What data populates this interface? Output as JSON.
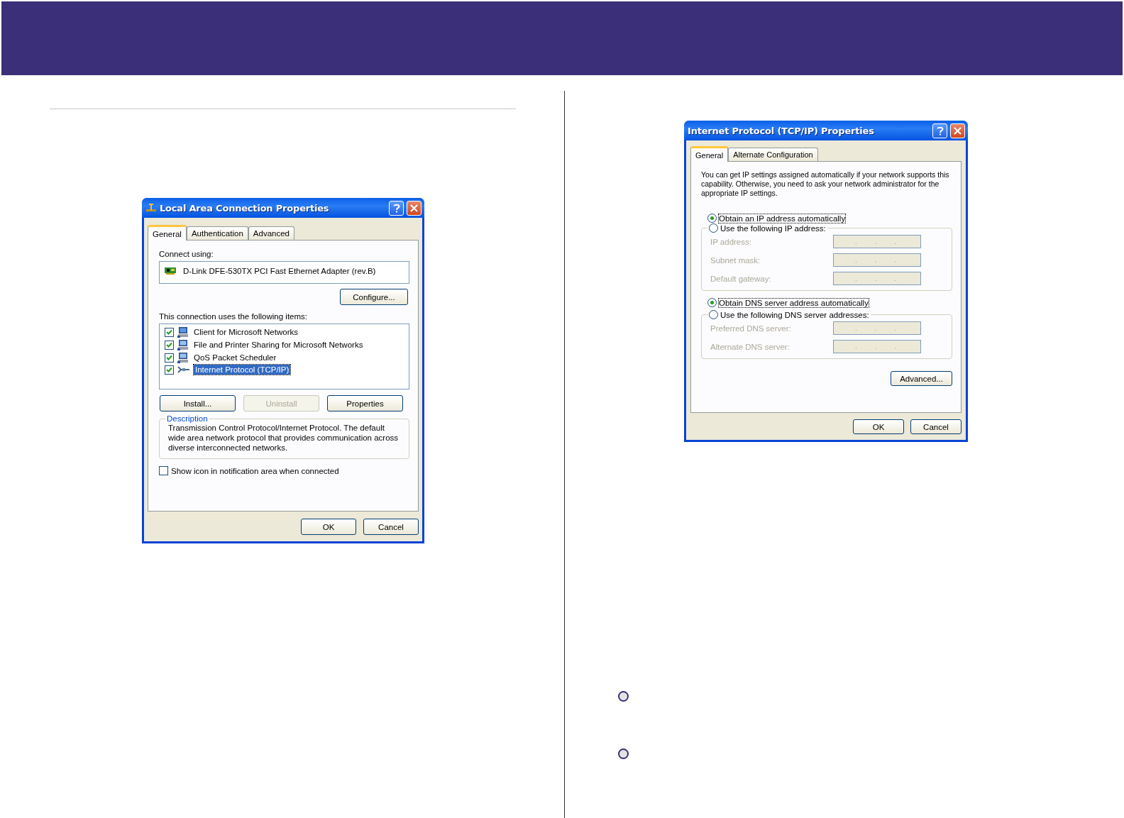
{
  "connection_dialog": {
    "title": "Local Area Connection Properties",
    "tabs": [
      {
        "label": "General",
        "selected": true
      },
      {
        "label": "Authentication",
        "selected": false
      },
      {
        "label": "Advanced",
        "selected": false
      }
    ],
    "connect_using_label": "Connect using:",
    "adapter": "D-Link DFE-530TX PCI Fast Ethernet Adapter (rev.B)",
    "configure_button": "Configure...",
    "items_label": "This connection uses the following items:",
    "items": [
      {
        "label": "Client for Microsoft Networks",
        "kind": "client",
        "checked": true,
        "selected": false
      },
      {
        "label": "File and Printer Sharing for Microsoft Networks",
        "kind": "service",
        "checked": true,
        "selected": false
      },
      {
        "label": "QoS Packet Scheduler",
        "kind": "service",
        "checked": true,
        "selected": false
      },
      {
        "label": "Internet Protocol (TCP/IP)",
        "kind": "protocol",
        "checked": true,
        "selected": true
      }
    ],
    "item_buttons": [
      {
        "label": "Install...",
        "disabled": false
      },
      {
        "label": "Uninstall",
        "disabled": true
      },
      {
        "label": "Properties",
        "disabled": false
      }
    ],
    "description": {
      "title": "Description",
      "text": "Transmission Control Protocol/Internet Protocol. The default wide area network protocol that provides communication across diverse interconnected networks."
    },
    "show_icon": {
      "label": "Show icon in notification area when connected",
      "checked": false
    },
    "footer_buttons": [
      "OK",
      "Cancel"
    ]
  },
  "tcpip_dialog": {
    "title": "Internet Protocol (TCP/IP) Properties",
    "tabs": [
      {
        "label": "General",
        "selected": true
      },
      {
        "label": "Alternate Configuration",
        "selected": false
      }
    ],
    "intro": "You can get IP settings assigned automatically if your network supports this capability. Otherwise, you need to ask your network administrator for the appropriate IP settings.",
    "ip_options": [
      {
        "label": "Obtain an IP address automatically",
        "selected": true
      },
      {
        "label": "Use the following IP address:",
        "selected": false
      }
    ],
    "ip_fields": [
      {
        "label": "IP address:",
        "value": ". . .",
        "disabled": true
      },
      {
        "label": "Subnet mask:",
        "value": ". . .",
        "disabled": true
      },
      {
        "label": "Default gateway:",
        "value": ". . .",
        "disabled": true
      }
    ],
    "dns_options": [
      {
        "label": "Obtain DNS server address automatically",
        "selected": true
      },
      {
        "label": "Use the following DNS server addresses:",
        "selected": false
      }
    ],
    "dns_fields": [
      {
        "label": "Preferred DNS server:",
        "value": ". . .",
        "disabled": true
      },
      {
        "label": "Alternate DNS server:",
        "value": ". . .",
        "disabled": true
      }
    ],
    "advanced_button": "Advanced...",
    "footer_buttons": [
      "OK",
      "Cancel"
    ]
  }
}
